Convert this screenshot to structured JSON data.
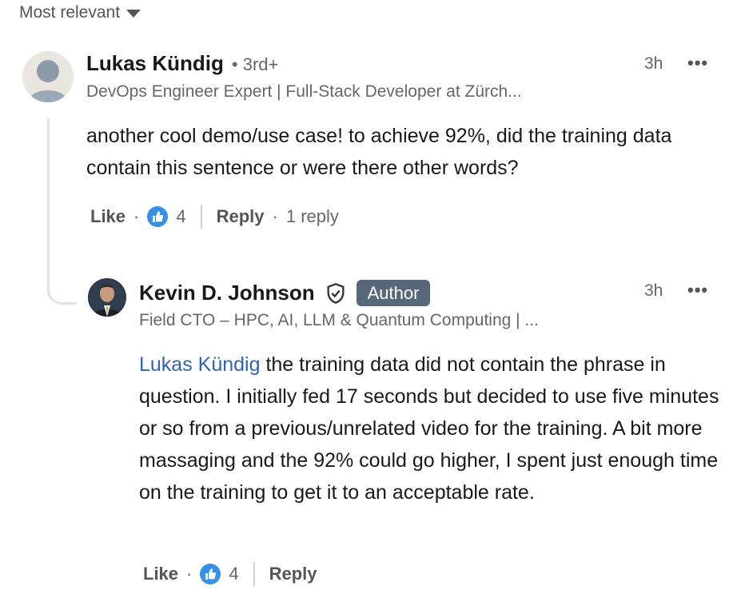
{
  "sort": {
    "label": "Most relevant"
  },
  "comment": {
    "author": "Lukas Kündig",
    "degree": "• 3rd+",
    "headline": "DevOps Engineer Expert | Full-Stack Developer at Zürch...",
    "time": "3h",
    "more": "•••",
    "text": "another cool demo/use case! to achieve 92%, did the training data contain this sentence or were there other words?",
    "like_label": "Like",
    "reaction_count": "4",
    "reply_label": "Reply",
    "replies_count": "1 reply",
    "dot": "·"
  },
  "reply": {
    "author": "Kevin D. Johnson",
    "badge": "Author",
    "headline": "Field CTO – HPC, AI, LLM & Quantum Computing | ...",
    "time": "3h",
    "more": "•••",
    "mention": "Lukas Kündig",
    "text": " the training data did not contain the phrase in question. I initially fed 17 seconds but decided to use five minutes or so from a previous/unrelated video for the training. A bit more massaging and the 92% could go higher, I spent just enough time on the training to get it to an acceptable rate.",
    "like_label": "Like",
    "reaction_count": "4",
    "reply_label": "Reply",
    "dot": "·"
  },
  "colors": {
    "mention": "#2d64bc",
    "like_badge": "#378fe9",
    "author_badge": "#56687a"
  },
  "icons": [
    "chevron-down-icon",
    "default-avatar",
    "thumbs-up-icon",
    "verified-shield-icon",
    "more-icon"
  ]
}
